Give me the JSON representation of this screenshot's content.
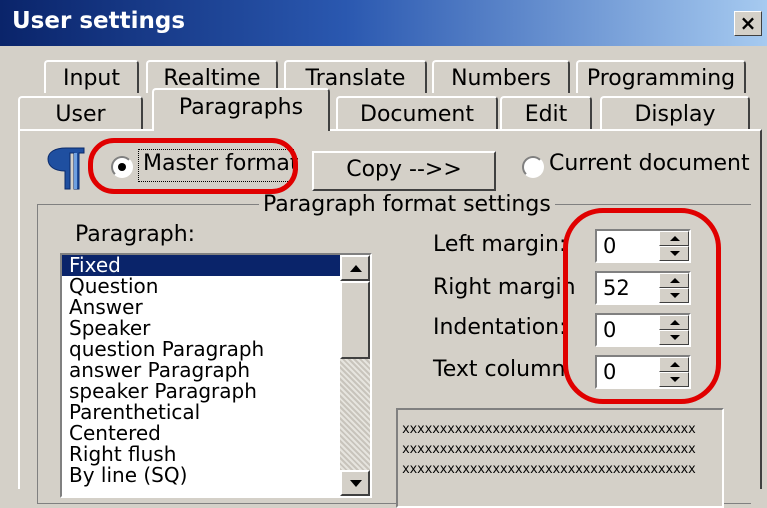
{
  "window": {
    "title": "User settings",
    "close_glyph": "×"
  },
  "tabs": {
    "row1": [
      "Input",
      "Realtime",
      "Translate",
      "Numbers",
      "Programming"
    ],
    "row2": [
      "User",
      "Paragraphs",
      "Document",
      "Edit",
      "Display"
    ],
    "active": "Paragraphs"
  },
  "format_mode": {
    "master_label": "Master format",
    "current_label": "Current document",
    "copy_button": "Copy -->>",
    "selected": "master"
  },
  "group": {
    "title": "Paragraph format settings"
  },
  "paragraph_list": {
    "label": "Paragraph:",
    "items": [
      "Fixed",
      "Question",
      "Answer",
      "Speaker",
      "question Paragraph",
      "answer Paragraph",
      "speaker Paragraph",
      "Parenthetical",
      "Centered",
      "Right flush",
      "By line (SQ)"
    ],
    "selected": "Fixed"
  },
  "fields": [
    {
      "label": "Left margin:",
      "value": "0"
    },
    {
      "label": "Right margin",
      "value": "52"
    },
    {
      "label": "Indentation:",
      "value": "0"
    },
    {
      "label": "Text column",
      "value": "0"
    }
  ],
  "preview": {
    "lines": [
      "xxxxxxxxxxxxxxxxxxxxxxxxxxxxxxxxxxxxxxx",
      "xxxxxxxxxxxxxxxxxxxxxxxxxxxxxxxxxxxxxxx",
      "xxxxxxxxxxxxxxxxxxxxxxxxxxxxxxxxxxxxxxx"
    ]
  },
  "colors": {
    "highlight": "#e00000",
    "selection": "#0a246a",
    "face": "#d4d0c8"
  }
}
